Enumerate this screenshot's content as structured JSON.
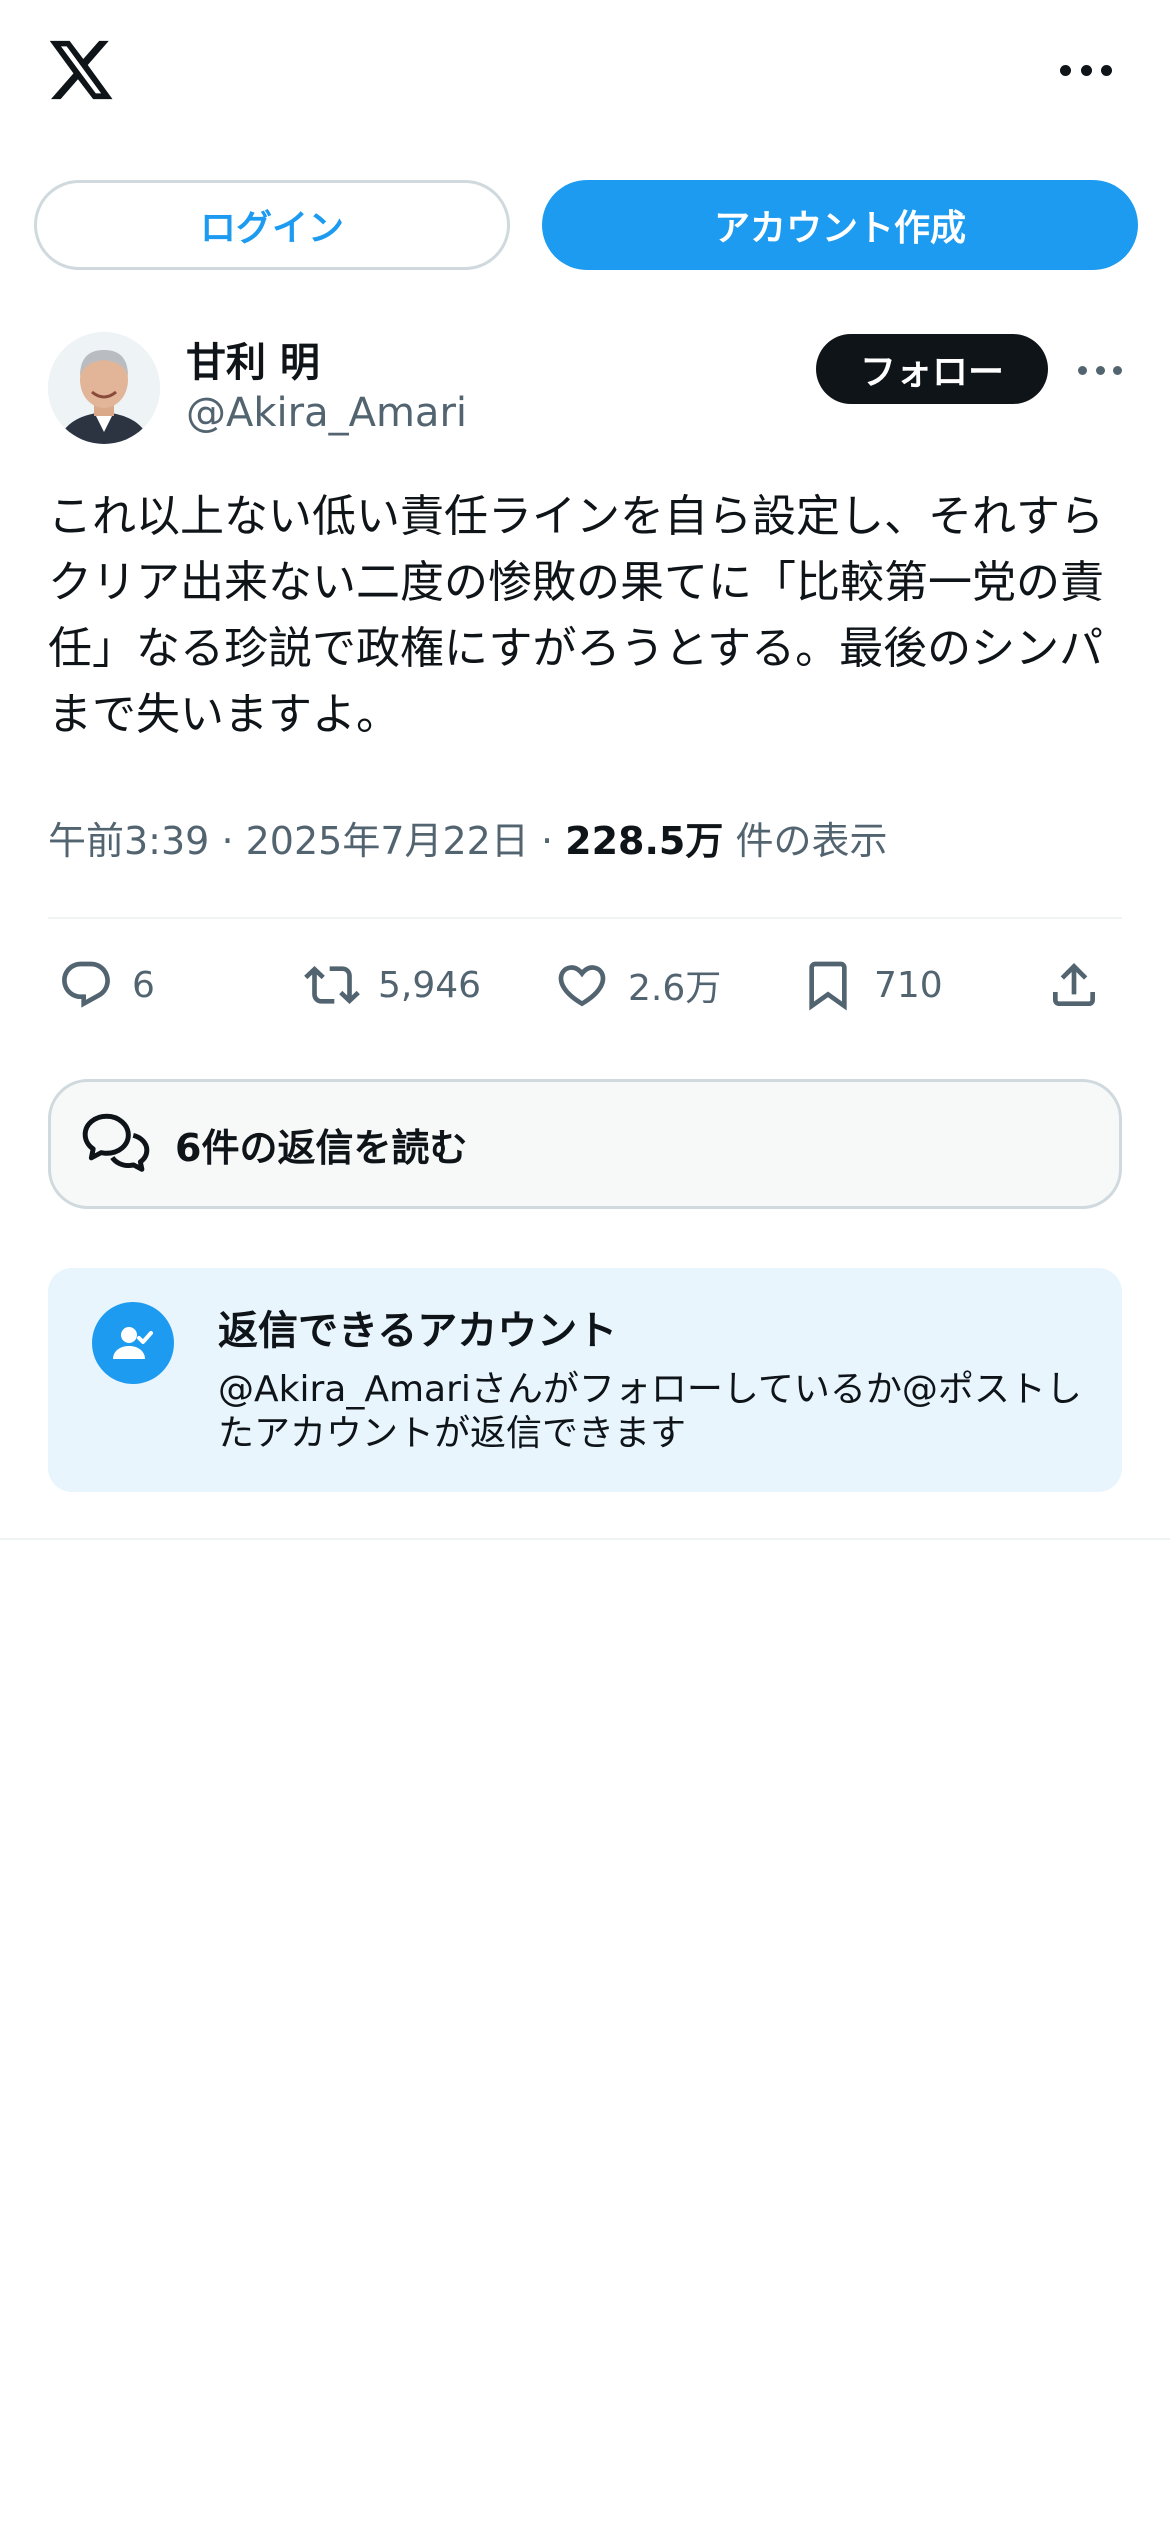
{
  "header": {
    "logo_icon": "x-logo-icon",
    "more_icon": "more-horizontal-icon"
  },
  "auth": {
    "login_label": "ログイン",
    "signup_label": "アカウント作成"
  },
  "post": {
    "author_name": "甘利 明",
    "author_handle": "@Akira_Amari",
    "follow_label": "フォロー",
    "text": "これ以上ない低い責任ラインを自ら設定し、それすらクリア出来ない二度の惨敗の果てに「比較第一党の責任」なる珍説で政権にすがろうとする。最後のシンパまで失いますよ。",
    "time": "午前3:39",
    "date": "2025年7月22日",
    "views_count": "228.5万",
    "views_label": "件の表示",
    "separator": "·"
  },
  "actions": {
    "replies": "6",
    "reposts": "5,946",
    "likes": "2.6万",
    "bookmarks": "710"
  },
  "read_replies": {
    "label": "6件の返信を読む"
  },
  "who_can_reply": {
    "title": "返信できるアカウント",
    "description": "@Akira_Amariさんがフォローしているか@ポストしたアカウントが返信できます"
  },
  "colors": {
    "accent": "#1d9bf0",
    "text": "#0f1419",
    "secondary": "#536471",
    "border": "#cfd9de",
    "info_bg": "#e8f5fd"
  }
}
